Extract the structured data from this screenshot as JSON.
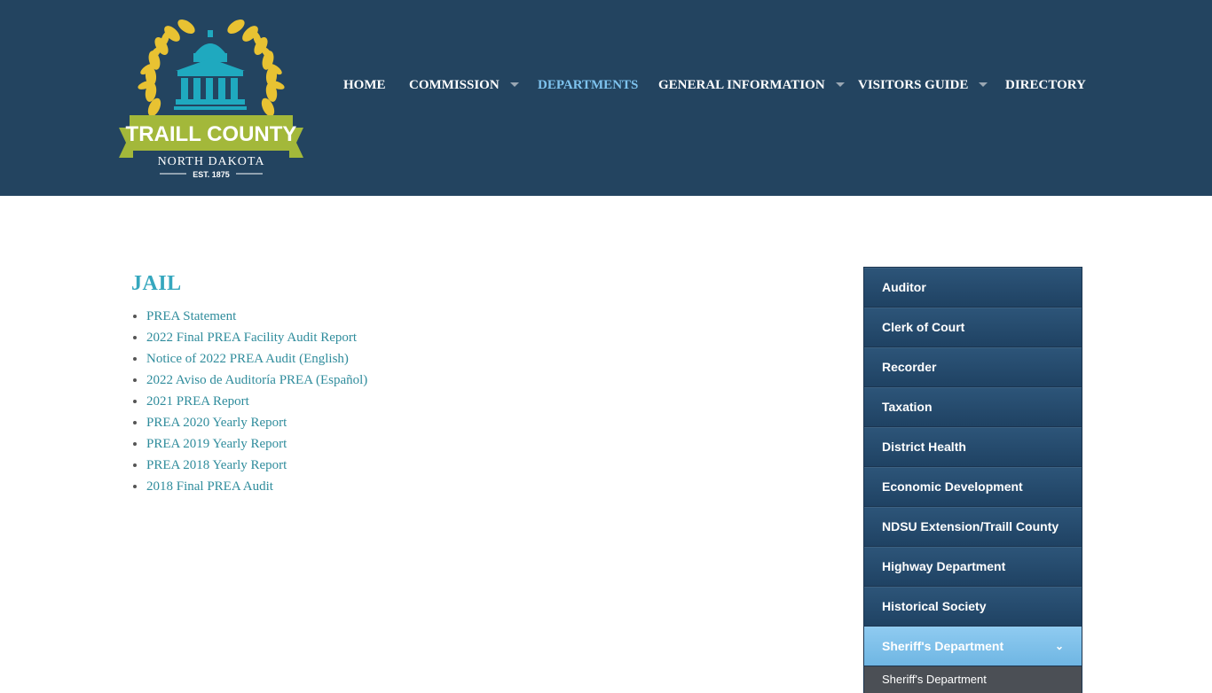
{
  "logo": {
    "name": "TRAILL COUNTY",
    "state": "NORTH DAKOTA",
    "established": "EST. 1875"
  },
  "nav": {
    "items": [
      {
        "label": "HOME",
        "dropdown": false,
        "active": false
      },
      {
        "label": "COMMISSION",
        "dropdown": true,
        "active": false
      },
      {
        "label": "DEPARTMENTS",
        "dropdown": false,
        "active": true
      },
      {
        "label": "GENERAL INFORMATION",
        "dropdown": true,
        "active": false
      },
      {
        "label": "VISITORS GUIDE",
        "dropdown": true,
        "active": false
      },
      {
        "label": "DIRECTORY",
        "dropdown": false,
        "active": false
      }
    ]
  },
  "main": {
    "title": "JAIL",
    "links": [
      "PREA Statement",
      "2022 Final PREA Facility Audit Report",
      "Notice of 2022 PREA Audit (English)",
      "2022 Aviso de Auditoría PREA (Español)",
      "2021 PREA Report",
      "PREA 2020 Yearly Report",
      "PREA 2019 Yearly Report",
      "PREA 2018 Yearly Report",
      "2018 Final PREA Audit"
    ]
  },
  "sidebar": {
    "items": [
      "Auditor",
      "Clerk of Court",
      "Recorder",
      "Taxation",
      "District Health",
      "Economic Development",
      "NDSU Extension/Traill County",
      "Highway Department",
      "Historical Society",
      "Sheriff's Department"
    ],
    "active_item": "Sheriff's Department",
    "chevron": "chevron-down-icon",
    "sub_item": "Sheriff's Department"
  },
  "colors": {
    "header_bg": "#234460",
    "nav_active": "#7ec3ee",
    "title": "#35a7be",
    "link": "#2f8c9c",
    "sidebar_bg": "#234a6b",
    "sidebar_active": "#7fc0ea",
    "logo_gold": "#e8c232",
    "logo_teal": "#1fa9bf",
    "logo_green": "#a3b83a"
  }
}
